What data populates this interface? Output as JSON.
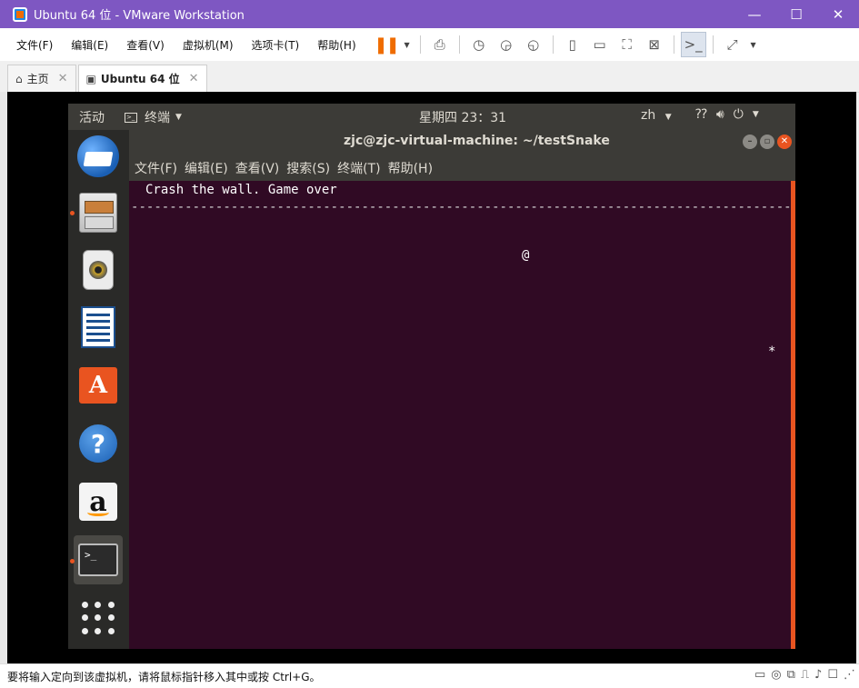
{
  "window": {
    "title": "Ubuntu 64 位 - VMware Workstation",
    "controls": [
      "—",
      "☐",
      "✕"
    ]
  },
  "menubar": {
    "items": [
      "文件(F)",
      "编辑(E)",
      "查看(V)",
      "虚拟机(M)",
      "选项卡(T)",
      "帮助(H)"
    ]
  },
  "tabs": [
    {
      "label": "主页",
      "icon": "home-icon",
      "close": "✕"
    },
    {
      "label": "Ubuntu 64 位",
      "icon": "vm-icon",
      "close": "✕"
    }
  ],
  "ubuntu": {
    "activities": "活动",
    "app_menu": "终端",
    "clock": "星期四 23：31",
    "lang": "zh",
    "lang_caret": "▾",
    "sys_icons": [
      "network-icon",
      "volume-icon",
      "power-icon"
    ]
  },
  "dock": {
    "items": [
      "thunderbird-icon",
      "files-icon",
      "rhythmbox-icon",
      "writer-icon",
      "software-icon",
      "help-icon",
      "amazon-icon",
      "terminal-icon",
      "show-apps-icon"
    ]
  },
  "terminal": {
    "title": "zjc@zjc-virtual-machine: ~/testSnake",
    "menu": [
      "文件(F)",
      "编辑(E)",
      "查看(V)",
      "搜索(S)",
      "终端(T)",
      "帮助(H)"
    ],
    "line1": "Crash the wall. Game over",
    "line2": "-----------------------------------------------------------------------------------------",
    "snake": "@",
    "food": "*"
  },
  "statusbar": {
    "message": "要将输入定向到该虚拟机，请将鼠标指针移入其中或按 Ctrl+G。"
  },
  "colors": {
    "titlebar": "#7e57c2",
    "terminal_bg": "#300a24",
    "ubuntu_orange": "#e95420"
  }
}
